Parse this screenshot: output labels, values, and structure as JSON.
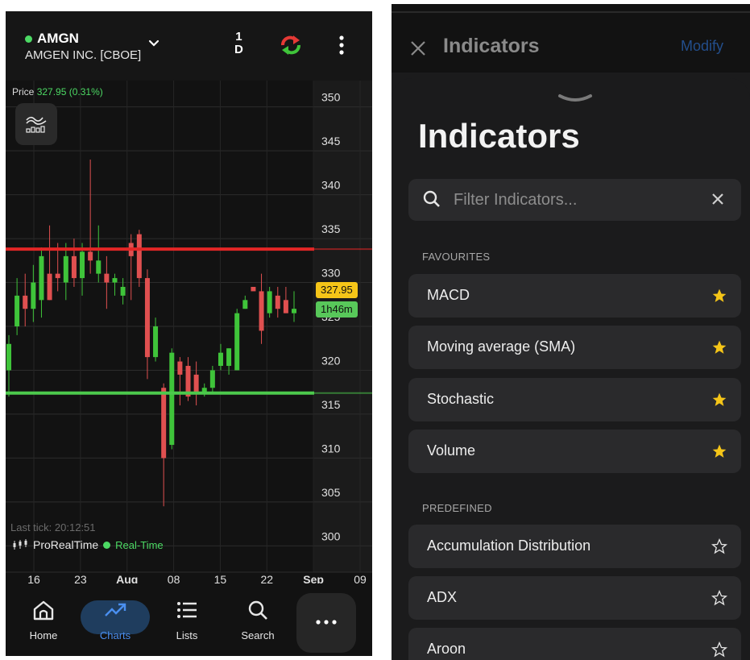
{
  "left": {
    "symbol": "AMGN",
    "symbol_name": "AMGEN INC. [CBOE]",
    "period_top": "1",
    "period_bottom": "D",
    "price_label": "Price",
    "price_value": "327.95 (0.31%)",
    "price_tag": "327.95",
    "time_tag": "1h46m",
    "last_tick": "Last tick: 20:12:51",
    "provider": "ProRealTime",
    "realtime": "Real-Time",
    "colors": {
      "up": "#3fc43a",
      "down": "#e05050",
      "resistance": "#e32626",
      "support": "#4cc94c",
      "accent": "#4a8ff0"
    },
    "nav": [
      {
        "label": "Home",
        "icon": "home-icon"
      },
      {
        "label": "Charts",
        "icon": "trend-icon"
      },
      {
        "label": "Lists",
        "icon": "list-icon"
      },
      {
        "label": "Search",
        "icon": "search-icon"
      }
    ],
    "more_icon": "more-dots-icon"
  },
  "chart_data": {
    "type": "candlestick",
    "y_ticks": [
      350,
      345,
      340,
      335,
      330,
      325,
      320,
      315,
      310,
      305,
      300
    ],
    "ylim": [
      297,
      353
    ],
    "x_ticks": [
      "16",
      "23",
      "Aug",
      "08",
      "15",
      "22",
      "Sep",
      "09"
    ],
    "grid": true,
    "horizontal_lines": [
      {
        "name": "resistance",
        "value": 333.8
      },
      {
        "name": "support",
        "value": 317.4
      }
    ],
    "candles": [
      {
        "o": 320.0,
        "h": 324.0,
        "l": 317.0,
        "c": 323.0
      },
      {
        "o": 325.0,
        "h": 330.5,
        "l": 324.0,
        "c": 328.5
      },
      {
        "o": 328.5,
        "h": 331.0,
        "l": 325.0,
        "c": 327.0
      },
      {
        "o": 327.0,
        "h": 332.0,
        "l": 325.5,
        "c": 330.0
      },
      {
        "o": 328.0,
        "h": 334.0,
        "l": 326.0,
        "c": 333.0
      },
      {
        "o": 331.0,
        "h": 336.5,
        "l": 328.0,
        "c": 328.0
      },
      {
        "o": 331.0,
        "h": 334.5,
        "l": 329.0,
        "c": 330.5
      },
      {
        "o": 330.0,
        "h": 334.5,
        "l": 328.0,
        "c": 333.0
      },
      {
        "o": 333.0,
        "h": 335.0,
        "l": 329.5,
        "c": 330.5
      },
      {
        "o": 330.5,
        "h": 334.5,
        "l": 328.5,
        "c": 333.5
      },
      {
        "o": 333.5,
        "h": 344.0,
        "l": 331.0,
        "c": 332.5
      },
      {
        "o": 331.0,
        "h": 336.5,
        "l": 330.0,
        "c": 332.5
      },
      {
        "o": 331.0,
        "h": 333.0,
        "l": 327.0,
        "c": 330.0
      },
      {
        "o": 330.0,
        "h": 331.0,
        "l": 328.5,
        "c": 330.5
      },
      {
        "o": 328.5,
        "h": 330.5,
        "l": 327.5,
        "c": 329.5
      },
      {
        "o": 334.5,
        "h": 335.5,
        "l": 328.0,
        "c": 333.0
      },
      {
        "o": 335.5,
        "h": 336.0,
        "l": 329.5,
        "c": 330.5
      },
      {
        "o": 330.5,
        "h": 331.5,
        "l": 319.0,
        "c": 321.5
      },
      {
        "o": 321.5,
        "h": 326.0,
        "l": 321.0,
        "c": 325.0
      },
      {
        "o": 318.0,
        "h": 318.5,
        "l": 304.5,
        "c": 310.0
      },
      {
        "o": 311.5,
        "h": 322.5,
        "l": 311.0,
        "c": 322.0
      },
      {
        "o": 321.0,
        "h": 321.5,
        "l": 316.0,
        "c": 319.5
      },
      {
        "o": 320.5,
        "h": 321.5,
        "l": 316.5,
        "c": 317.0
      },
      {
        "o": 319.5,
        "h": 321.0,
        "l": 316.0,
        "c": 317.5
      },
      {
        "o": 317.5,
        "h": 318.5,
        "l": 317.0,
        "c": 318.0
      },
      {
        "o": 318.0,
        "h": 320.5,
        "l": 317.5,
        "c": 320.0
      },
      {
        "o": 320.5,
        "h": 323.0,
        "l": 320.0,
        "c": 322.0
      },
      {
        "o": 320.5,
        "h": 322.5,
        "l": 319.5,
        "c": 322.5
      },
      {
        "o": 320.0,
        "h": 327.0,
        "l": 320.0,
        "c": 326.5
      },
      {
        "o": 327.0,
        "h": 328.5,
        "l": 327.0,
        "c": 328.0
      },
      {
        "o": 329.5,
        "h": 329.5,
        "l": 329.5,
        "c": 329.0
      },
      {
        "o": 329.0,
        "h": 331.0,
        "l": 323.0,
        "c": 324.5
      },
      {
        "o": 326.5,
        "h": 329.5,
        "l": 326.0,
        "c": 329.0
      },
      {
        "o": 328.5,
        "h": 329.5,
        "l": 326.0,
        "c": 327.0
      },
      {
        "o": 328.0,
        "h": 329.5,
        "l": 326.5,
        "c": 326.5
      },
      {
        "o": 326.5,
        "h": 329.0,
        "l": 325.5,
        "c": 327.0
      }
    ]
  },
  "right": {
    "header_title": "Indicators",
    "modify_label": "Modify",
    "sheet_title": "Indicators",
    "search_placeholder": "Filter Indicators...",
    "favourites_label": "FAVOURITES",
    "favourites": [
      "MACD",
      "Moving average (SMA)",
      "Stochastic",
      "Volume"
    ],
    "predefined_label": "PREDEFINED",
    "predefined": [
      "Accumulation Distribution",
      "ADX",
      "Aroon"
    ],
    "colors": {
      "star_filled": "#f5c518",
      "modify": "#234e8c"
    }
  }
}
